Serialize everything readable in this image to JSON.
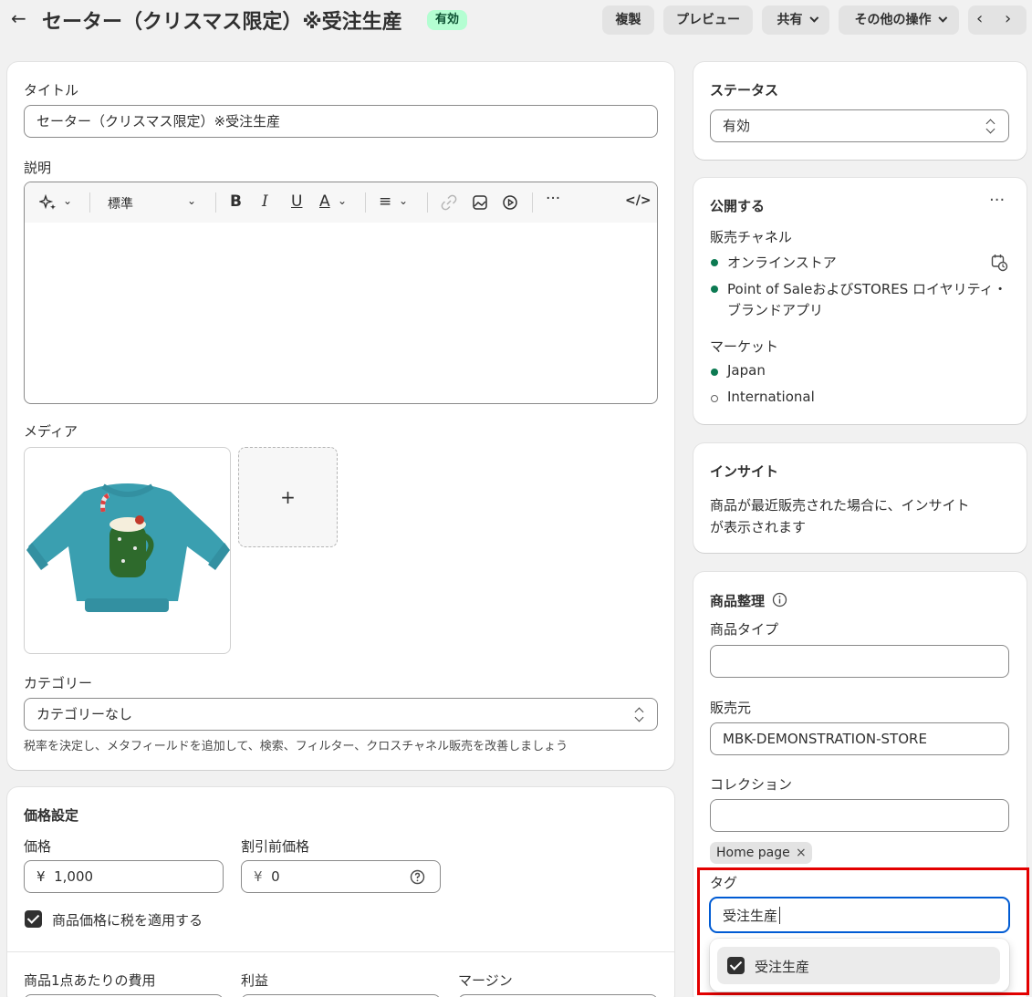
{
  "header": {
    "title": "セーター（クリスマス限定）※受注生産",
    "status_badge": "有効",
    "buttons": {
      "duplicate": "複製",
      "preview": "プレビュー",
      "share": "共有",
      "more_actions": "その他の操作"
    }
  },
  "main": {
    "title_label": "タイトル",
    "title_value": "セーター（クリスマス限定）※受注生産",
    "description_label": "説明",
    "toolbar": {
      "format_value": "標準"
    },
    "media_label": "メディア",
    "media_add": "+",
    "category_label": "カテゴリー",
    "category_value": "カテゴリーなし",
    "category_hint": "税率を決定し、メタフィールドを追加して、検索、フィルター、クロスチャネル販売を改善しましょう"
  },
  "pricing": {
    "heading": "価格設定",
    "price_label": "価格",
    "price_currency": "¥",
    "price_value": "1,000",
    "compare_label": "割引前価格",
    "compare_currency": "¥",
    "compare_value": "0",
    "tax_checkbox_label": "商品価格に税を適用する",
    "tax_checked": true,
    "cost_label": "商品1点あたりの費用",
    "profit_label": "利益",
    "margin_label": "マージン"
  },
  "sidebar": {
    "status": {
      "heading": "ステータス",
      "value": "有効"
    },
    "publishing": {
      "heading": "公開する",
      "channels_label": "販売チャネル",
      "channels": [
        {
          "name": "オンラインストア",
          "active": true
        },
        {
          "name": "Point of SaleおよびSTORES ロイヤリティ・",
          "name2": "ブランドアプリ",
          "active": true
        }
      ],
      "markets_label": "マーケット",
      "markets": [
        {
          "name": "Japan",
          "active": true
        },
        {
          "name": "International",
          "active": false
        }
      ]
    },
    "insights": {
      "heading": "インサイト",
      "line1": "商品が最近販売された場合に、インサイト",
      "line2": "が表示されます"
    },
    "organization": {
      "heading": "商品整理",
      "type_label": "商品タイプ",
      "type_value": "",
      "vendor_label": "販売元",
      "vendor_value": "MBK-DEMONSTRATION-STORE",
      "collections_label": "コレクション",
      "collections_value": "",
      "collection_chips": [
        "Home page"
      ],
      "tags_label": "タグ",
      "tags_input": "受注生産",
      "tag_suggestion": "受注生産",
      "tag_suggestion_checked": true
    }
  },
  "colors": {
    "accent": "#005bd3",
    "highlight": "#e30000",
    "active_dot": "#0c7a52",
    "badge_bg": "#b4fed2"
  },
  "icons": [
    "back-arrow-icon",
    "chevron-down-icon",
    "chevron-left-icon",
    "chevron-right-icon",
    "magic-icon",
    "bold-icon",
    "italic-icon",
    "underline-icon",
    "text-color-icon",
    "align-icon",
    "link-icon",
    "image-icon",
    "video-icon",
    "more-icon",
    "code-icon",
    "calendar-clock-icon",
    "info-icon",
    "help-circle-icon",
    "close-icon",
    "checkbox-checked-icon",
    "sweater-image"
  ]
}
